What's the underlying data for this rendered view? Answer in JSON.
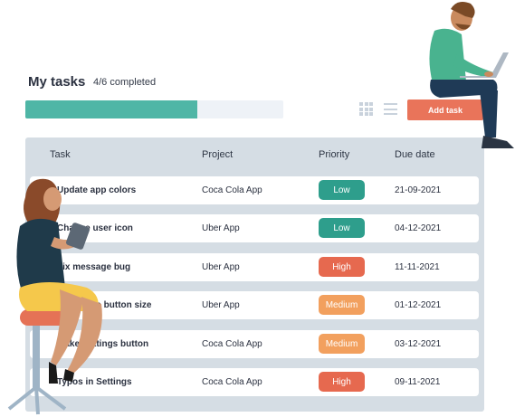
{
  "header": {
    "title": "My tasks",
    "progress_text": "4/6 completed",
    "progress_fraction": 0.6667,
    "add_task_label": "Add task"
  },
  "colors": {
    "accent_teal": "#4fb6a6",
    "low": "#2e9e8c",
    "high": "#e6694f",
    "medium": "#f2a05e",
    "button": "#e9745a",
    "table_bg": "#d5dde4"
  },
  "icons": [
    "grid-view-icon",
    "list-view-icon"
  ],
  "table": {
    "columns": [
      "Task",
      "Project",
      "Priority",
      "Due date"
    ],
    "rows": [
      {
        "task": "Update app colors",
        "project": "Coca Cola App",
        "priority": "Low",
        "due": "21-09-2021"
      },
      {
        "task": "Change user icon",
        "project": "Uber App",
        "priority": "Low",
        "due": "04-12-2021"
      },
      {
        "task": "Fix message bug",
        "project": "Uber App",
        "priority": "High",
        "due": "11-11-2021"
      },
      {
        "task": "Change to button size",
        "project": "Uber App",
        "priority": "Medium",
        "due": "01-12-2021"
      },
      {
        "task": "Make Settings button",
        "project": "Coca Cola App",
        "priority": "Medium",
        "due": "03-12-2021"
      },
      {
        "task": "Typos in Settings",
        "project": "Coca Cola App",
        "priority": "High",
        "due": "09-11-2021"
      }
    ]
  }
}
